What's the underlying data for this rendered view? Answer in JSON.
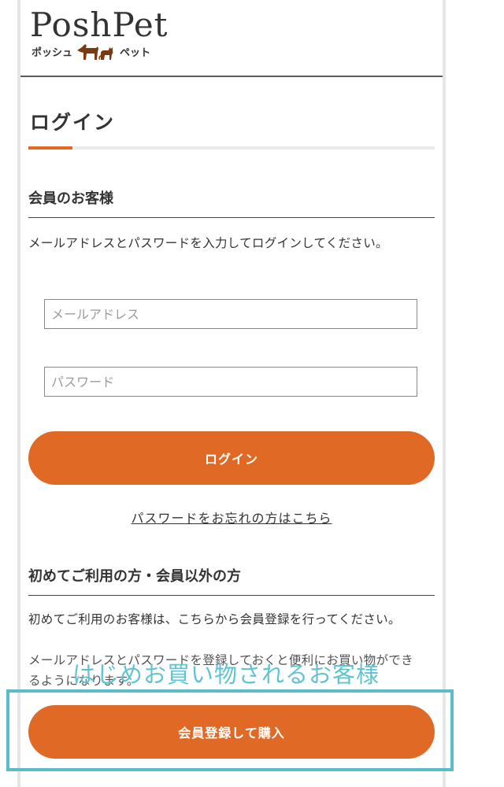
{
  "header": {
    "logo_text": "PoshPet",
    "logo_sub_left": "ポッシュ",
    "logo_sub_right": "ペット"
  },
  "page": {
    "title": "ログイン"
  },
  "member": {
    "heading": "会員のお客様",
    "description": "メールアドレスとパスワードを入力してログインしてください。",
    "email_placeholder": "メールアドレス",
    "password_placeholder": "パスワード",
    "login_button": "ログイン",
    "forgot_link": "パスワードをお忘れの方はこちら"
  },
  "guest": {
    "heading": "初めてご利用の方・会員以外の方",
    "description_1": "初めてご利用のお客様は、こちらから会員登録を行ってください。",
    "description_2": "メールアドレスとパスワードを登録しておくと便利にお買い物ができるようになります。",
    "register_button": "会員登録して購入"
  },
  "annotation": {
    "caption": "はじめお買い物されるお客様"
  },
  "colors": {
    "accent": "#e06a25",
    "annotation": "#5bbcc9"
  }
}
